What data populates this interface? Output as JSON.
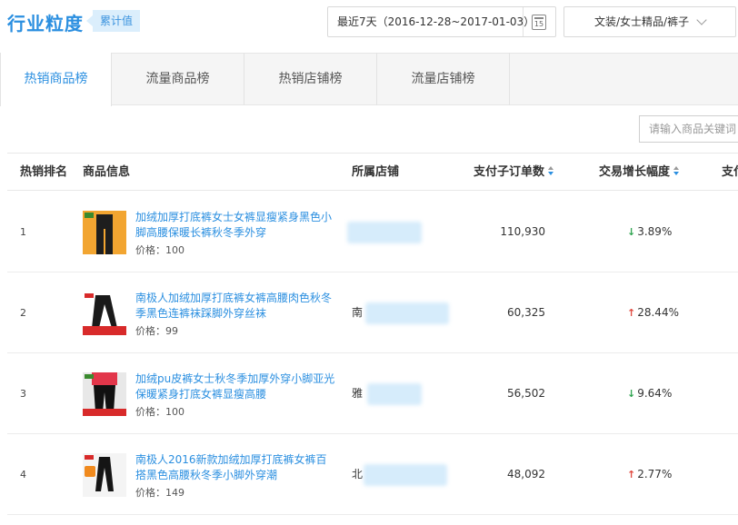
{
  "header": {
    "title": "行业粒度",
    "badge": "累计值",
    "date_range": "最近7天（2016-12-28~2017-01-03）",
    "calendar_day": "15",
    "category": "文装/女士精品/裤子"
  },
  "tabs": [
    {
      "label": "热销商品榜",
      "active": true
    },
    {
      "label": "流量商品榜",
      "active": false
    },
    {
      "label": "热销店铺榜",
      "active": false
    },
    {
      "label": "流量店铺榜",
      "active": false
    }
  ],
  "search": {
    "placeholder": "请输入商品关键词"
  },
  "table": {
    "columns": [
      "热销排名",
      "商品信息",
      "所属店铺",
      "支付子订单数",
      "交易增长幅度",
      "支付"
    ],
    "rows": [
      {
        "rank": "1",
        "name": "加绒加厚打底裤女士女裤显瘦紧身黑色小脚高腰保暖长裤秋冬季外穿",
        "price": "价格：100",
        "shop": "",
        "orders": "110,930",
        "growth": "3.89%",
        "trend": "down"
      },
      {
        "rank": "2",
        "name": "南极人加绒加厚打底裤女裤高腰肉色秋冬季黑色连裤袜踩脚外穿丝袜",
        "price": "价格：99",
        "shop": "南",
        "orders": "60,325",
        "growth": "28.44%",
        "trend": "up"
      },
      {
        "rank": "3",
        "name": "加绒pu皮裤女士秋冬季加厚外穿小脚亚光保暖紧身打底女裤显瘦高腰",
        "price": "价格：100",
        "shop": "雅",
        "orders": "56,502",
        "growth": "9.64%",
        "trend": "down"
      },
      {
        "rank": "4",
        "name": "南极人2016新款加绒加厚打底裤女裤百搭黑色高腰秋冬季小脚外穿潮",
        "price": "价格：149",
        "shop": "北",
        "orders": "48,092",
        "growth": "2.77%",
        "trend": "up"
      }
    ]
  },
  "colors": {
    "accent": "#2b8fe0",
    "down": "#2ea44f",
    "up": "#e0483e"
  }
}
